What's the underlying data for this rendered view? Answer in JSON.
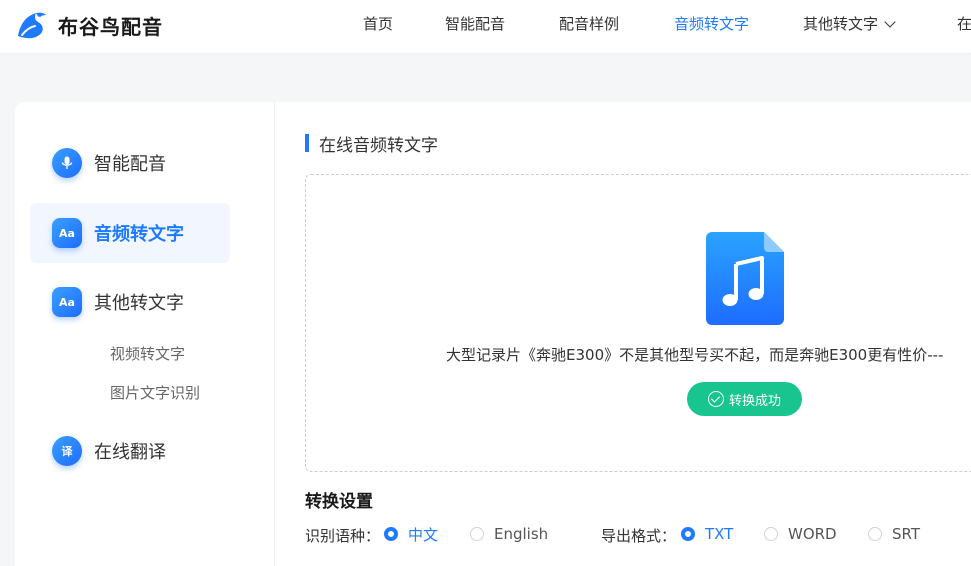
{
  "brand": {
    "name": "布谷鸟配音"
  },
  "nav": [
    {
      "label": "首页"
    },
    {
      "label": "智能配音"
    },
    {
      "label": "配音样例"
    },
    {
      "label": "音频转文字"
    },
    {
      "label": "其他转文字"
    },
    {
      "label": "在"
    }
  ],
  "sidebar": {
    "items": [
      {
        "label": "智能配音",
        "icon": "microphone-icon"
      },
      {
        "label": "音频转文字",
        "icon": "text-aa-icon",
        "icon_text": "Aa"
      },
      {
        "label": "其他转文字",
        "icon": "text-aa-icon",
        "icon_text": "Aa"
      },
      {
        "label": "在线翻译",
        "icon": "translate-icon",
        "icon_text": "译"
      }
    ],
    "sub_items": [
      {
        "label": "视频转文字"
      },
      {
        "label": "图片文字识别"
      }
    ]
  },
  "content": {
    "section_title": "在线音频转文字",
    "file_name": "大型记录片《奔驰E300》不是其他型号买不起，而是奔驰E300更有性价---",
    "status_label": "转换成功",
    "settings_title": "转换设置",
    "language_label": "识别语种：",
    "language_options": [
      {
        "label": "中文",
        "selected": true
      },
      {
        "label": "English",
        "selected": false
      }
    ],
    "format_label": "导出格式：",
    "format_options": [
      {
        "label": "TXT",
        "selected": true
      },
      {
        "label": "WORD",
        "selected": false
      },
      {
        "label": "SRT",
        "selected": false
      }
    ]
  },
  "colors": {
    "accent": "#1e7bff",
    "success": "#19c58f"
  }
}
